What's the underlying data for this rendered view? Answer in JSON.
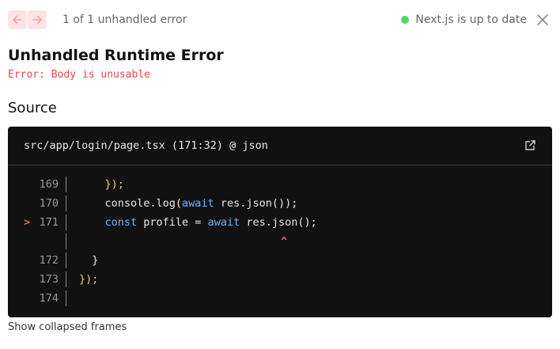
{
  "toolbar": {
    "error_count": "1 of 1 unhandled error",
    "status_text": "Next.js is up to date",
    "prev_icon": "arrow-left-icon",
    "next_icon": "arrow-right-icon",
    "close_icon": "close-icon"
  },
  "error": {
    "title": "Unhandled Runtime Error",
    "message": "Error: Body is unusable"
  },
  "source": {
    "heading": "Source",
    "file_ref": "src/app/login/page.tsx (171:32) @ json",
    "open_icon": "external-link-icon",
    "lines": [
      {
        "number": "169",
        "marker": "",
        "tokens": [
          {
            "t": "    ",
            "c": ""
          },
          {
            "t": "});",
            "c": "pn"
          }
        ]
      },
      {
        "number": "170",
        "marker": "",
        "tokens": [
          {
            "t": "    console.log(",
            "c": ""
          },
          {
            "t": "await",
            "c": "kw"
          },
          {
            "t": " res.json());",
            "c": ""
          }
        ]
      },
      {
        "number": "171",
        "marker": ">",
        "tokens": [
          {
            "t": "    ",
            "c": ""
          },
          {
            "t": "const",
            "c": "kw"
          },
          {
            "t": " profile = ",
            "c": ""
          },
          {
            "t": "await",
            "c": "kw"
          },
          {
            "t": " res.json();",
            "c": ""
          }
        ]
      },
      {
        "number": "",
        "marker": "",
        "caret": "^",
        "tokens": []
      },
      {
        "number": "172",
        "marker": "",
        "tokens": [
          {
            "t": "  }",
            "c": ""
          }
        ]
      },
      {
        "number": "173",
        "marker": "",
        "tokens": [
          {
            "t": "});",
            "c": "pn"
          }
        ]
      },
      {
        "number": "174",
        "marker": "",
        "tokens": []
      }
    ]
  },
  "footer": {
    "collapsed_label": "Show collapsed frames"
  },
  "colors": {
    "error_red": "#e5484d",
    "status_green": "#4cd964",
    "code_bg": "#111111",
    "keyword_blue": "#6cb6ff",
    "punct_yellow": "#f0c674",
    "nav_btn_bg": "#fde4e4"
  }
}
